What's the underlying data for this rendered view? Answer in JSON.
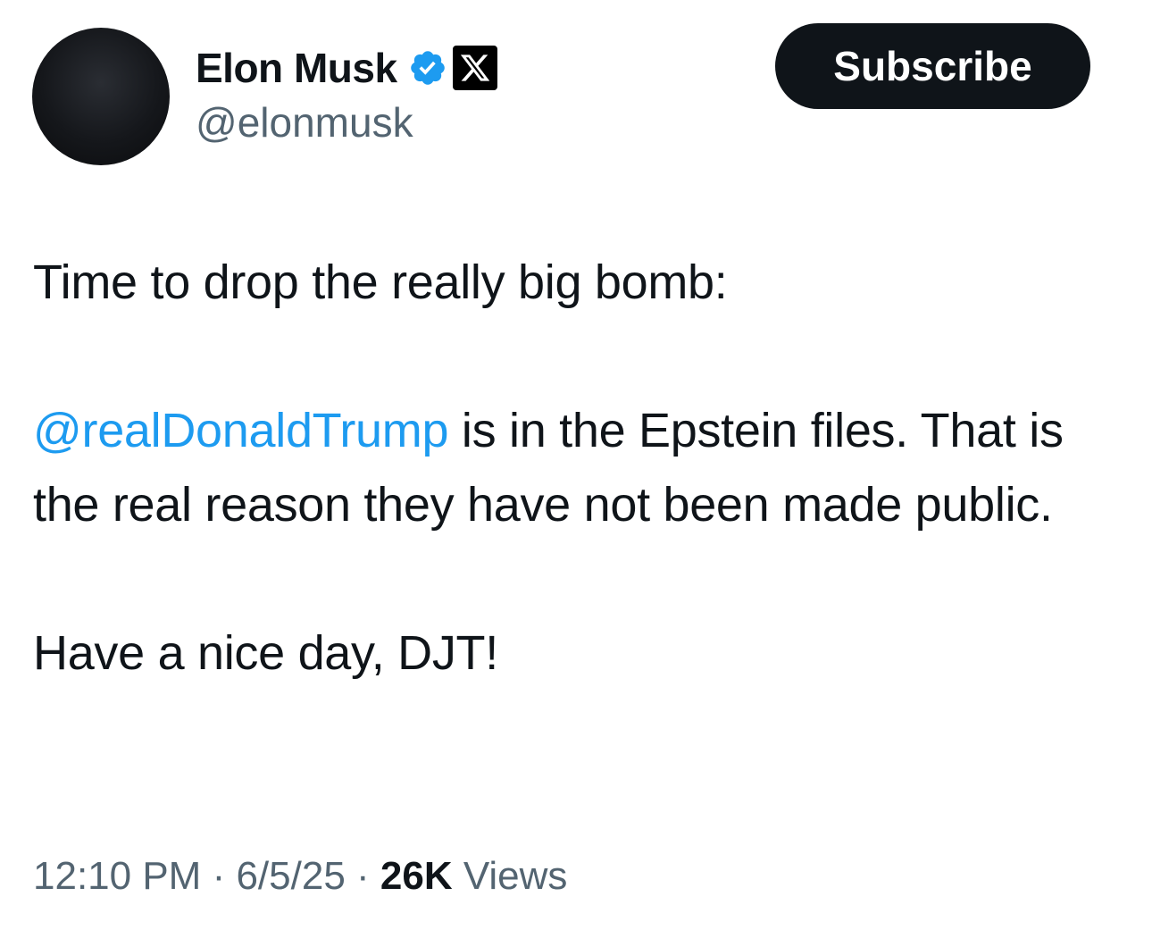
{
  "author": {
    "display_name": "Elon Musk",
    "handle": "@elonmusk",
    "verified_icon": "verified-badge-icon",
    "affiliate_icon": "x-logo-icon"
  },
  "subscribe_label": "Subscribe",
  "tweet": {
    "line1": "Time to drop the really big bomb:",
    "mention": "@realDonaldTrump",
    "line2_rest": " is in the Epstein files. That is the real reason they have not been made public.",
    "line3": "Have a nice day, DJT!"
  },
  "meta": {
    "time": "12:10 PM",
    "sep1": " · ",
    "date": "6/5/25",
    "sep2": " · ",
    "views_count": "26K",
    "views_label": " Views"
  },
  "colors": {
    "link": "#1d9bf0",
    "text": "#0f1419",
    "secondary": "#536471",
    "verified": "#1d9bf0"
  }
}
